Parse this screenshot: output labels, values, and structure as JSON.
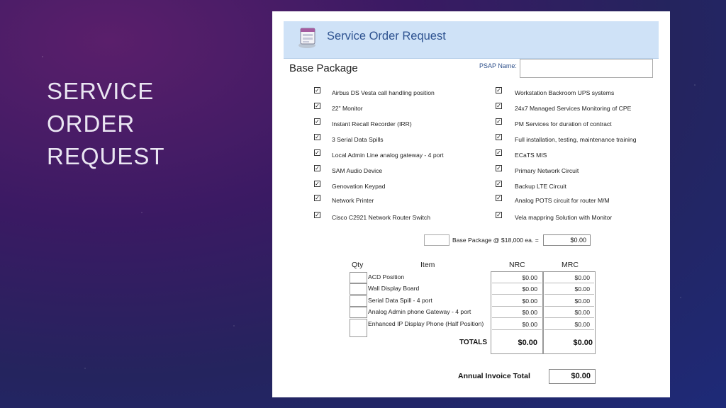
{
  "slide": {
    "title_lines": [
      "SERVICE",
      "ORDER",
      "REQUEST"
    ]
  },
  "form": {
    "icon": "form-icon",
    "header_title": "Service Order Request",
    "section_title": "Base Package",
    "psap_label": "PSAP Name:",
    "psap_value": "",
    "left_items": [
      {
        "label": "Airbus DS Vesta call handling position",
        "checked": true
      },
      {
        "label": "22\" Monitor",
        "checked": true
      },
      {
        "label": "Instant Recall Recorder (IRR)",
        "checked": true
      },
      {
        "label": "3 Serial Data Spills",
        "checked": true
      },
      {
        "label": "Local Admin Line analog gateway - 4 port",
        "checked": true
      },
      {
        "label": "SAM Audio Device",
        "checked": true
      },
      {
        "label": "Genovation Keypad",
        "checked": true
      },
      {
        "label": "Network Printer",
        "checked": true
      },
      {
        "label": "Cisco C2921 Network Router  Switch",
        "checked": true
      }
    ],
    "right_items": [
      {
        "label": "Workstation  Backroom UPS systems",
        "checked": true
      },
      {
        "label": "24x7 Managed Services Monitoring of CPE",
        "checked": true
      },
      {
        "label": "PM Services for duration of contract",
        "checked": true
      },
      {
        "label": "Full installation, testing, maintenance  training",
        "checked": true
      },
      {
        "label": "ECaTS MIS",
        "checked": true
      },
      {
        "label": "Primary Network Circuit",
        "checked": true
      },
      {
        "label": "Backup LTE Circuit",
        "checked": true
      },
      {
        "label": "Analog POTS circuit for router M/M",
        "checked": true
      },
      {
        "label": "Vela mappring Solution with Monitor",
        "checked": true
      }
    ],
    "base_package": {
      "qty": "",
      "label": "Base Package @ $18,000 ea. =",
      "total": "$0.00"
    },
    "table": {
      "headers": {
        "qty": "Qty",
        "item": "Item",
        "nrc": "NRC",
        "mrc": "MRC"
      },
      "rows": [
        {
          "item": "ACD Position",
          "nrc": "$0.00",
          "mrc": "$0.00"
        },
        {
          "item": "Wall Display Board",
          "nrc": "$0.00",
          "mrc": "$0.00"
        },
        {
          "item": "Serial Data Spill - 4 port",
          "nrc": "$0.00",
          "mrc": "$0.00"
        },
        {
          "item": "Analog Admin phone Gateway - 4 port",
          "nrc": "$0.00",
          "mrc": "$0.00"
        },
        {
          "item": "Enhanced IP Display Phone (Half Position)",
          "nrc": "$0.00",
          "mrc": "$0.00"
        }
      ],
      "totals_label": "TOTALS",
      "total_nrc": "$0.00",
      "total_mrc": "$0.00"
    },
    "annual_label": "Annual Invoice Total",
    "annual_total": "$0.00"
  }
}
